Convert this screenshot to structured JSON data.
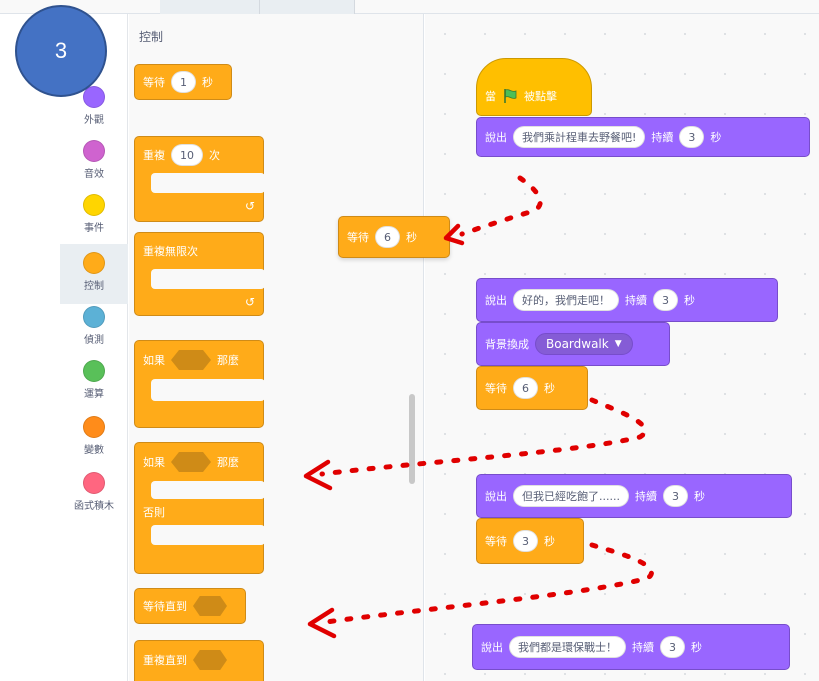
{
  "badge": {
    "number": "3"
  },
  "palette": {
    "title": "控制"
  },
  "categories": [
    {
      "label": "外觀",
      "color": "#9966ff"
    },
    {
      "label": "音效",
      "color": "#cf63cf"
    },
    {
      "label": "事件",
      "color": "#ffd500"
    },
    {
      "label": "控制",
      "color": "#ffab19"
    },
    {
      "label": "偵測",
      "color": "#5cb1d6"
    },
    {
      "label": "運算",
      "color": "#59c059"
    },
    {
      "label": "變數",
      "color": "#ff8c1a"
    },
    {
      "label": "函式積木",
      "color": "#ff6680"
    }
  ],
  "palette_blocks": {
    "wait": {
      "pre": "等待",
      "value": "1",
      "post": "秒"
    },
    "repeat": {
      "pre": "重複",
      "value": "10",
      "post": "次"
    },
    "forever": {
      "label": "重複無限次"
    },
    "if_then": {
      "pre": "如果",
      "post": "那麼"
    },
    "if_else": {
      "pre": "如果",
      "post": "那麼",
      "else": "否則"
    },
    "wait_until": {
      "label": "等待直到"
    },
    "repeat_until": {
      "label": "重複直到"
    }
  },
  "floating_block": {
    "pre": "等待",
    "value": "6",
    "post": "秒"
  },
  "script1": {
    "hat": {
      "pre": "當",
      "post": "被點擊"
    },
    "say": {
      "pre": "說出",
      "text": "我們乘計程車去野餐吧!",
      "mid": "持續",
      "secs": "3",
      "post": "秒"
    }
  },
  "script2": {
    "say": {
      "pre": "說出",
      "text": "好的，我們走吧！",
      "mid": "持續",
      "secs": "3",
      "post": "秒"
    },
    "backdrop": {
      "pre": "背景換成",
      "value": "Boardwalk"
    },
    "wait": {
      "pre": "等待",
      "value": "6",
      "post": "秒"
    }
  },
  "script3": {
    "say": {
      "pre": "說出",
      "text": "但我已經吃飽了......",
      "mid": "持續",
      "secs": "3",
      "post": "秒"
    },
    "wait": {
      "pre": "等待",
      "value": "3",
      "post": "秒"
    }
  },
  "script4": {
    "say": {
      "pre": "說出",
      "text": "我們都是環保戰士！",
      "mid": "持續",
      "secs": "3",
      "post": "秒"
    }
  },
  "colors": {
    "annotation": "#e00000",
    "control": "#ffab19",
    "looks": "#9966ff",
    "events": "#ffbf00"
  }
}
